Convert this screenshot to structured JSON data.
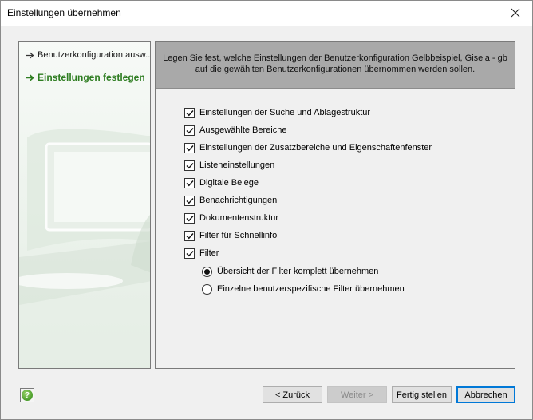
{
  "window": {
    "title": "Einstellungen übernehmen"
  },
  "steps": [
    {
      "label": "Benutzerkonfiguration ausw..."
    },
    {
      "label": "Einstellungen festlegen"
    }
  ],
  "header": {
    "text": "Legen Sie fest, welche Einstellungen der Benutzerkonfiguration Gelbbeispiel, Gisela - gb auf die gewählten Benutzerkonfigurationen übernommen werden sollen."
  },
  "options": [
    {
      "label": "Einstellungen der Suche und Ablagestruktur",
      "checked": true
    },
    {
      "label": "Ausgewählte Bereiche",
      "checked": true
    },
    {
      "label": "Einstellungen der Zusatzbereiche und Eigenschaftenfenster",
      "checked": true
    },
    {
      "label": "Listeneinstellungen",
      "checked": true
    },
    {
      "label": "Digitale Belege",
      "checked": true
    },
    {
      "label": "Benachrichtigungen",
      "checked": true
    },
    {
      "label": "Dokumentenstruktur",
      "checked": true
    },
    {
      "label": "Filter für Schnellinfo",
      "checked": true
    },
    {
      "label": "Filter",
      "checked": true
    }
  ],
  "filter_radio": [
    {
      "label": "Übersicht der Filter komplett übernehmen",
      "selected": true
    },
    {
      "label": "Einzelne benutzerspezifische Filter übernehmen",
      "selected": false
    }
  ],
  "buttons": {
    "back": "< Zurück",
    "next": "Weiter >",
    "finish": "Fertig stellen",
    "cancel": "Abbrechen",
    "help_icon": "?"
  },
  "colors": {
    "active_step": "#2e7d21",
    "header_bg": "#a9a9a9",
    "default_button_border": "#0078d7"
  }
}
